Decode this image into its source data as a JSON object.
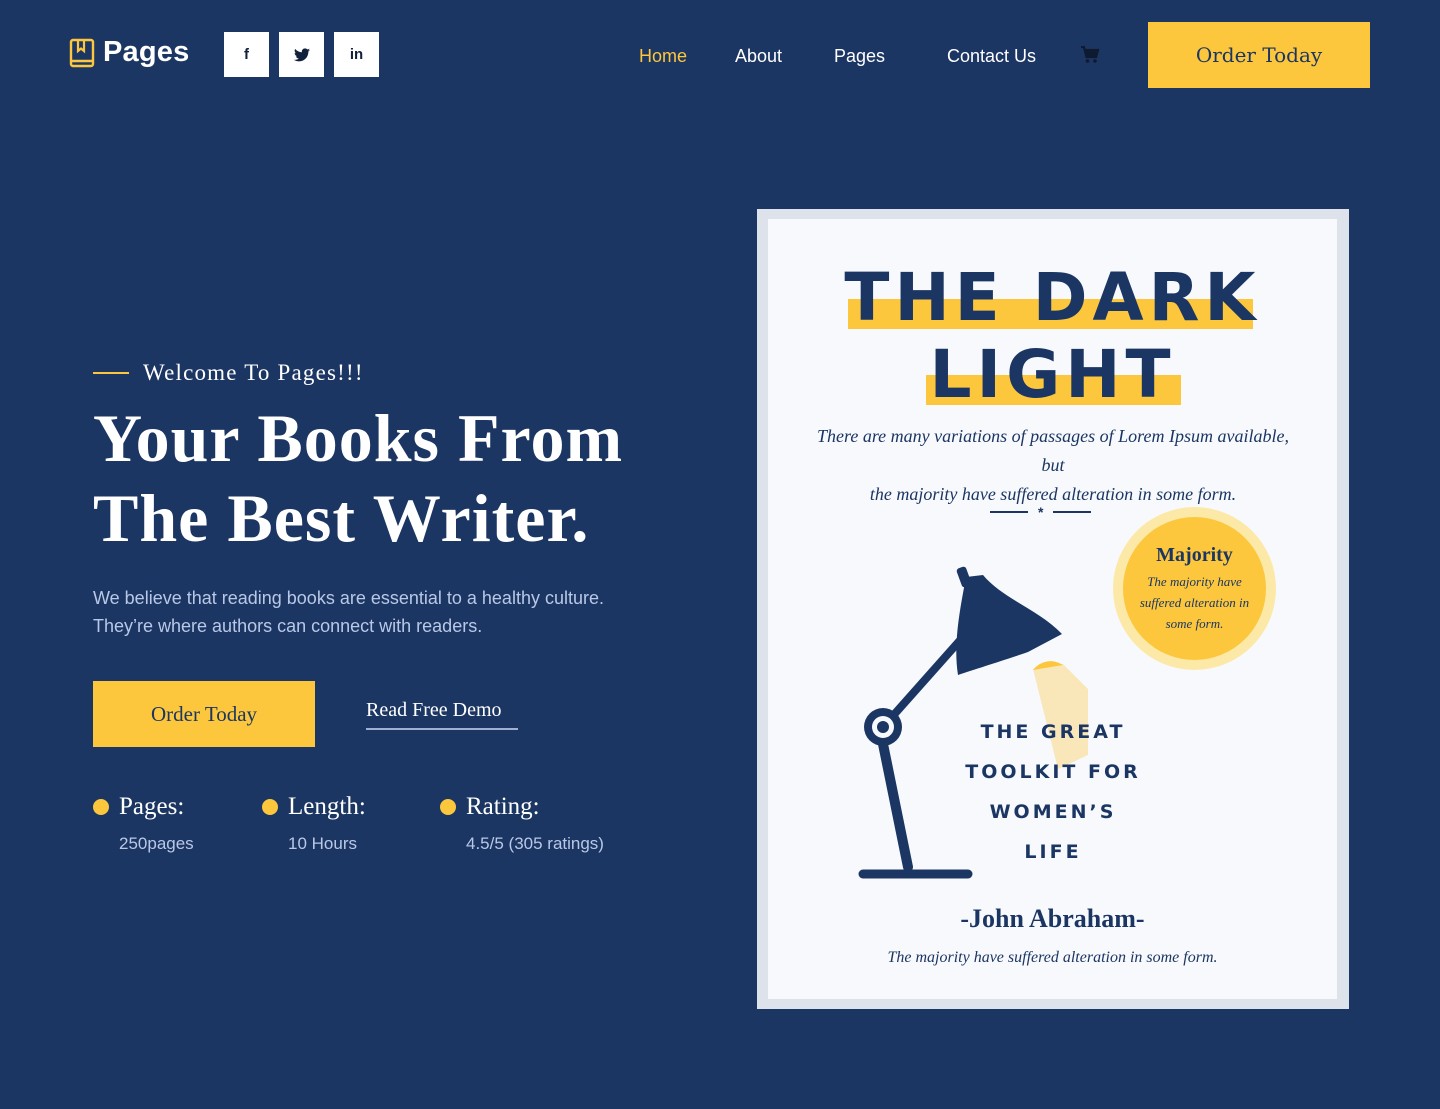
{
  "brand": {
    "name": "Pages",
    "icon": "book-icon"
  },
  "socials": [
    {
      "name": "facebook",
      "glyph": "f"
    },
    {
      "name": "twitter",
      "glyph": "t"
    },
    {
      "name": "linkedin",
      "glyph": "in"
    }
  ],
  "nav": {
    "items": [
      "Home",
      "About",
      "Pages",
      "Contact Us"
    ],
    "active": "Home",
    "cart_icon": "cart-icon",
    "cta": "Order Today"
  },
  "hero": {
    "eyebrow": "Welcome To Pages!!!",
    "headline_line1": "Your Books From",
    "headline_line2": "The Best Writer.",
    "description_line1": "We believe that reading books are essential to a healthy culture.",
    "description_line2": "They’re where authors can connect with readers.",
    "primary_cta": "Order Today",
    "secondary_cta": "Read Free Demo",
    "stats": [
      {
        "label": "Pages:",
        "value": "250pages"
      },
      {
        "label": "Length:",
        "value": "10 Hours"
      },
      {
        "label": "Rating:",
        "value": "4.5/5 (305 ratings)"
      }
    ]
  },
  "book": {
    "title_line1": "THE DARK",
    "title_line2": "LIGHT",
    "blurb_line1": "There are many variations of passages of Lorem Ipsum available, but",
    "blurb_line2": "the majority have suffered alteration in some form.",
    "divider_glyph": "*",
    "badge": {
      "title": "Majority",
      "line1": "The majority have",
      "line2": "suffered alteration in",
      "line3": "some form."
    },
    "subtitle": [
      "THE GREAT",
      "TOOLKIT FOR",
      "WOMEN’S",
      "LIFE"
    ],
    "author": "-John Abraham-",
    "author_note": "The majority have suffered alteration in some form."
  },
  "colors": {
    "background": "#1c3663",
    "accent": "#fcc73d",
    "muted_text": "#b9c8e6",
    "book_paper": "#f7f9fd"
  }
}
